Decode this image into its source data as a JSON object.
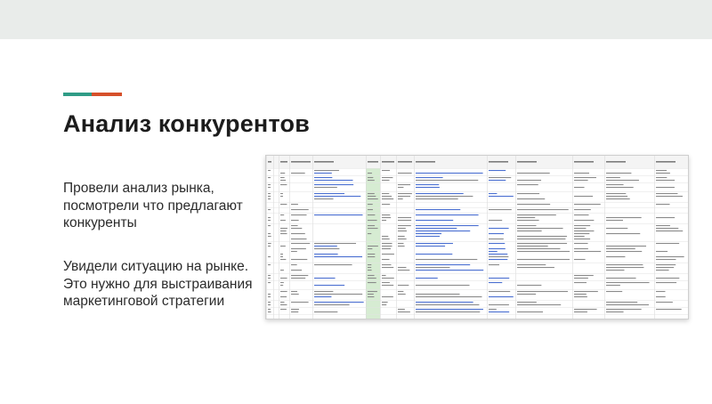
{
  "slide": {
    "title": "Анализ конкурентов",
    "paragraph_1": "Провели анализ рынка, посмотрели что предлагают конкуренты",
    "paragraph_2": "Увидели ситуацию на рынке. Это нужно для выстраивания маркетинговой стратегии"
  },
  "colors": {
    "accent_teal": "#2f9c86",
    "accent_red": "#d6502a",
    "top_bar": "#e9ecea",
    "sheet_highlight_column": "#d6ecd2"
  },
  "screenshot": {
    "kind": "spreadsheet-image",
    "column_count": 12
  }
}
